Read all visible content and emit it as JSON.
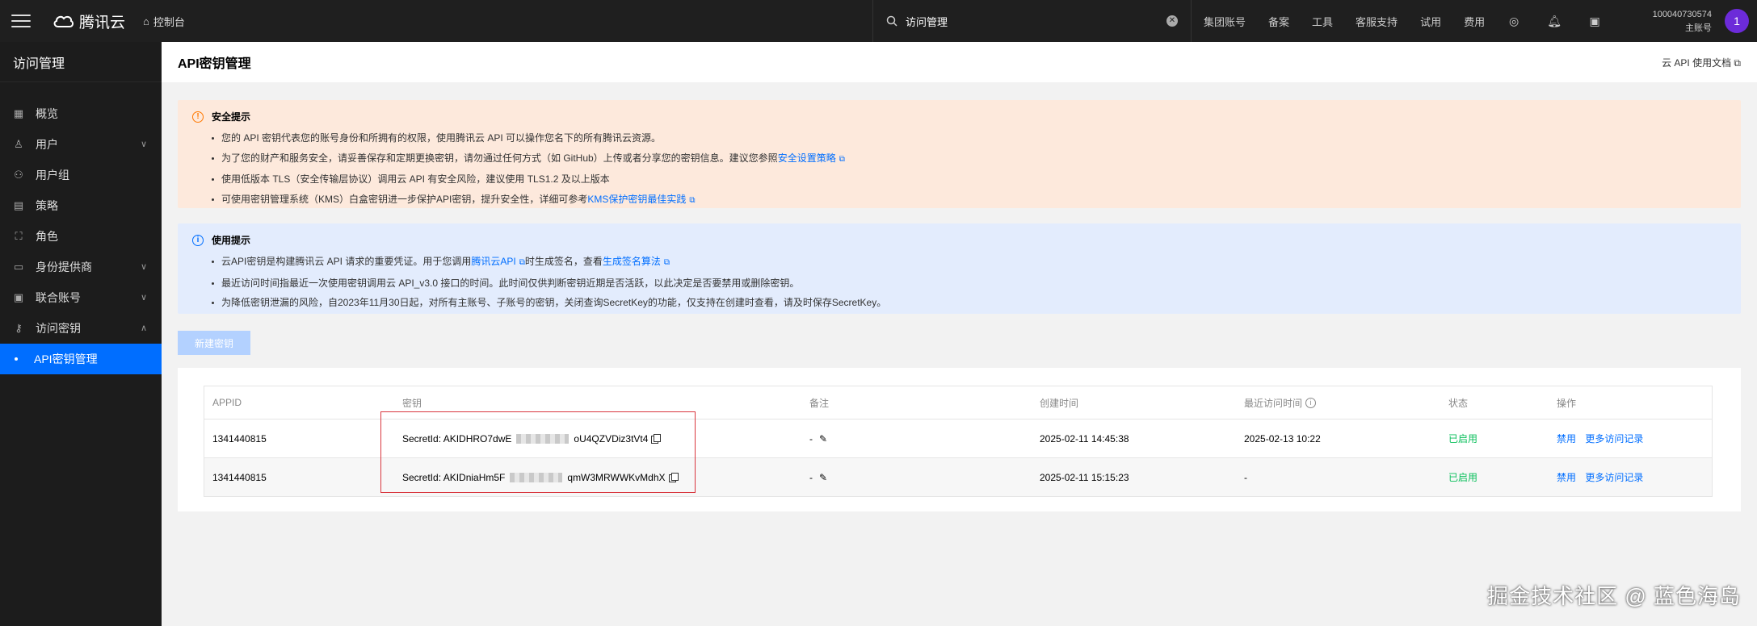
{
  "topbar": {
    "brand": "腾讯云",
    "console": "控制台",
    "search_value": "访问管理",
    "links": [
      "集团账号",
      "备案",
      "工具",
      "客服支持",
      "试用",
      "费用"
    ],
    "account_id": "100040730574",
    "account_role": "主账号",
    "avatar_letter": "1"
  },
  "sidebar": {
    "title": "访问管理",
    "items": [
      {
        "label": "概览",
        "icon": "grid-icon",
        "chevron": false
      },
      {
        "label": "用户",
        "icon": "user-icon",
        "chevron": true
      },
      {
        "label": "用户组",
        "icon": "user-group-icon",
        "chevron": false
      },
      {
        "label": "策略",
        "icon": "policy-icon",
        "chevron": false
      },
      {
        "label": "角色",
        "icon": "role-icon",
        "chevron": false
      },
      {
        "label": "身份提供商",
        "icon": "idp-icon",
        "chevron": true
      },
      {
        "label": "联合账号",
        "icon": "federated-icon",
        "chevron": true
      },
      {
        "label": "访问密钥",
        "icon": "key-icon",
        "chevron": true
      }
    ],
    "active_sub": "API密钥管理"
  },
  "page": {
    "title": "API密钥管理",
    "doc_link": "云 API 使用文档"
  },
  "security_tip": {
    "title": "安全提示",
    "items": [
      {
        "text": "您的 API 密钥代表您的账号身份和所拥有的权限，使用腾讯云 API 可以操作您名下的所有腾讯云资源。",
        "link": ""
      },
      {
        "text": "为了您的财产和服务安全，请妥善保存和定期更换密钥，请勿通过任何方式（如 GitHub）上传或者分享您的密钥信息。建议您参照",
        "link": "安全设置策略"
      },
      {
        "text": "使用低版本 TLS（安全传输层协议）调用云 API 有安全风险，建议使用 TLS1.2 及以上版本",
        "link": ""
      },
      {
        "text": "可使用密钥管理系统（KMS）白盒密钥进一步保护API密钥，提升安全性，详细可参考",
        "link": "KMS保护密钥最佳实践"
      }
    ]
  },
  "usage_tip": {
    "title": "使用提示",
    "item1_pre": "云API密钥是构建腾讯云 API 请求的重要凭证。用于您调用",
    "item1_link1": "腾讯云API",
    "item1_mid": "时生成签名，查看",
    "item1_link2": "生成签名算法",
    "item2": "最近访问时间指最近一次使用密钥调用云 API_v3.0 接口的时间。此时间仅供判断密钥近期是否活跃，以此决定是否要禁用或删除密钥。",
    "item3": "为降低密钥泄漏的风险，自2023年11月30日起，对所有主账号、子账号的密钥，关闭查询SecretKey的功能，仅支持在创建时查看，请及时保存SecretKey。"
  },
  "new_key_button": "新建密钥",
  "table": {
    "headers": [
      "APPID",
      "密钥",
      "备注",
      "创建时间",
      "最近访问时间",
      "状态",
      "操作"
    ],
    "rows": [
      {
        "appid": "1341440815",
        "key_prefix": "SecretId: AKIDHRO7dwE",
        "key_suffix": "oU4QZVDiz3tVt4",
        "note": "-",
        "created": "2025-02-11 14:45:38",
        "last_access": "2025-02-13 10:22",
        "status": "已启用",
        "op1": "禁用",
        "op2": "更多访问记录"
      },
      {
        "appid": "1341440815",
        "key_prefix": "SecretId: AKIDniaHm5F",
        "key_suffix": "qmW3MRWWKvMdhX",
        "note": "-",
        "created": "2025-02-11 15:15:23",
        "last_access": "-",
        "status": "已启用",
        "op1": "禁用",
        "op2": "更多访问记录"
      }
    ]
  },
  "watermark": "掘金技术社区 @ 蓝色海岛"
}
